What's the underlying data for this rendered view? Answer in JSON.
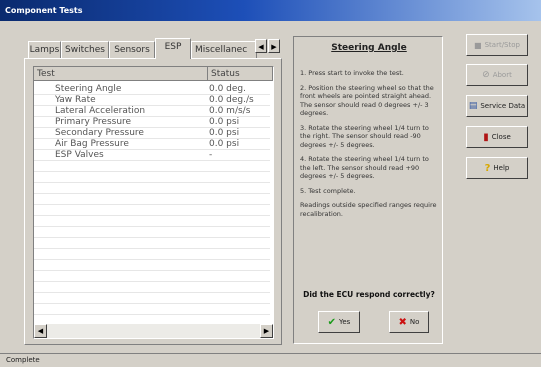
{
  "window": {
    "title": "Component Tests"
  },
  "tabs": [
    {
      "label": "Lamps"
    },
    {
      "label": "Switches"
    },
    {
      "label": "Sensors"
    },
    {
      "label": "ESP"
    },
    {
      "label": "Miscellanec"
    }
  ],
  "tab_scroll": {
    "left_icon": "chevron-left-icon",
    "right_icon": "chevron-right-icon",
    "left_glyph": "◀",
    "right_glyph": "▶"
  },
  "table": {
    "columns": [
      "Test",
      "Status"
    ],
    "rows": [
      {
        "test": "Steering Angle",
        "status": "0.0 deg."
      },
      {
        "test": "Yaw Rate",
        "status": "0.0 deg./s"
      },
      {
        "test": "Lateral Acceleration",
        "status": "0.0 m/s/s"
      },
      {
        "test": "Primary Pressure",
        "status": "0.0 psi"
      },
      {
        "test": "Secondary Pressure",
        "status": "0.0 psi"
      },
      {
        "test": "Air Bag Pressure",
        "status": "0.0 psi"
      },
      {
        "test": "ESP Valves",
        "status": "-"
      }
    ],
    "scroll_left_glyph": "◀",
    "scroll_right_glyph": "▶"
  },
  "instructions": {
    "title": "Steering Angle",
    "steps": [
      "1. Press start to invoke the test.",
      "2. Position the steering wheel so that the front wheels are pointed straight ahead. The sensor should read 0 degrees +/- 3 degrees.",
      "3. Rotate the steering wheel 1/4 turn to the right. The sensor should read -90 degrees +/- 5 degrees.",
      "4. Rotate the steering wheel 1/4 turn to the left. The sensor should read +90 degrees +/- 5 degrees.",
      "5. Test complete.",
      "Readings outside specified ranges require recalibration."
    ],
    "question": "Did the ECU respond correctly?",
    "yes_label": "Yes",
    "no_label": "No",
    "yes_glyph": "✔",
    "no_glyph": "✖"
  },
  "side_buttons": {
    "start_stop": "Start/Stop",
    "start_stop_glyph": "■",
    "start_stop_icon": "start-stop-icon",
    "abort": "Abort",
    "abort_glyph": "⊘",
    "abort_icon": "abort-icon",
    "service_data": "Service Data",
    "service_data_glyph": "▤",
    "service_data_icon": "service-data-icon",
    "close": "Close",
    "close_glyph": "▮",
    "close_icon": "exit-door-icon",
    "help": "Help",
    "help_glyph": "?",
    "help_icon": "help-icon"
  },
  "status_bar": {
    "text": "Complete"
  },
  "colors": {
    "titlebar_start": "#0a2a6e",
    "titlebar_end": "#a6c3ec",
    "yes_check": "#1a9a1a",
    "no_x": "#cc1111",
    "help_q": "#d8a800",
    "close_icon": "#b01515"
  }
}
